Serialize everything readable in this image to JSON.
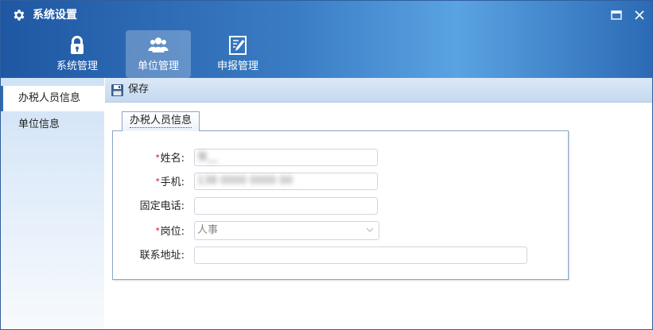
{
  "window": {
    "title": "系统设置"
  },
  "nav": [
    {
      "label": "系统管理",
      "icon": "lock-icon"
    },
    {
      "label": "单位管理",
      "icon": "users-icon",
      "active": true
    },
    {
      "label": "申报管理",
      "icon": "edit-document-icon"
    }
  ],
  "sidebar": {
    "items": [
      {
        "label": "办税人员信息",
        "active": true
      },
      {
        "label": "单位信息"
      }
    ]
  },
  "toolbar": {
    "save_label": "保存"
  },
  "tab": {
    "label": "办税人员信息"
  },
  "form": {
    "required_mark": "*",
    "name": {
      "label": "姓名:",
      "value": "张__"
    },
    "mobile": {
      "label": "手机:",
      "value": "138 0000 0000 00"
    },
    "phone": {
      "label": "固定电话:",
      "value": ""
    },
    "position": {
      "label": "岗位:",
      "value": "人事"
    },
    "address": {
      "label": "联系地址:",
      "value": ""
    }
  },
  "colors": {
    "accent": "#2d6db6",
    "required": "#d0021b",
    "header_start": "#1f57a3",
    "header_end": "#5aa3e2"
  }
}
